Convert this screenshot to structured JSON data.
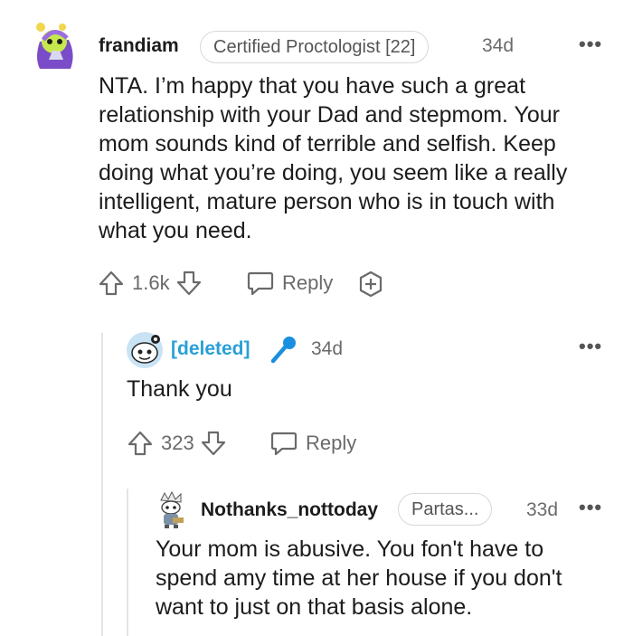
{
  "comment1": {
    "username": "frandiam",
    "flair": "Certified Proctologist [22]",
    "time": "34d",
    "more": "•••",
    "lines": [
      "NTA. I’m happy that you have such a great",
      "relationship with your Dad and stepmom. Your",
      "mom sounds kind of terrible and selfish. Keep",
      "doing what you’re doing, you seem like a really",
      "intelligent, mature person who is in touch with",
      "what you need."
    ],
    "votes": "1.6k",
    "reply_label": "Reply"
  },
  "comment2": {
    "username": "[deleted]",
    "time": "34d",
    "more": "•••",
    "text": "Thank you",
    "votes": "323",
    "reply_label": "Reply"
  },
  "comment3": {
    "username": "Nothanks_nottoday",
    "flair": "Partas...",
    "time": "33d",
    "more": "•••",
    "lines": [
      "Your mom is abusive. You fon't have to",
      "spend amy time at her house if you don't",
      "want to just on that basis alone."
    ]
  },
  "colors": {
    "deleted_blue": "#2a9fd6",
    "mic_blue": "#1a8fe0",
    "text": "#1c1c1c",
    "meta": "#6a6a6a"
  },
  "icons": {
    "upvote": "arrow-up-outline",
    "downvote": "arrow-down-outline",
    "reply": "speech-bubble",
    "award": "plus-award",
    "mic": "microphone"
  }
}
